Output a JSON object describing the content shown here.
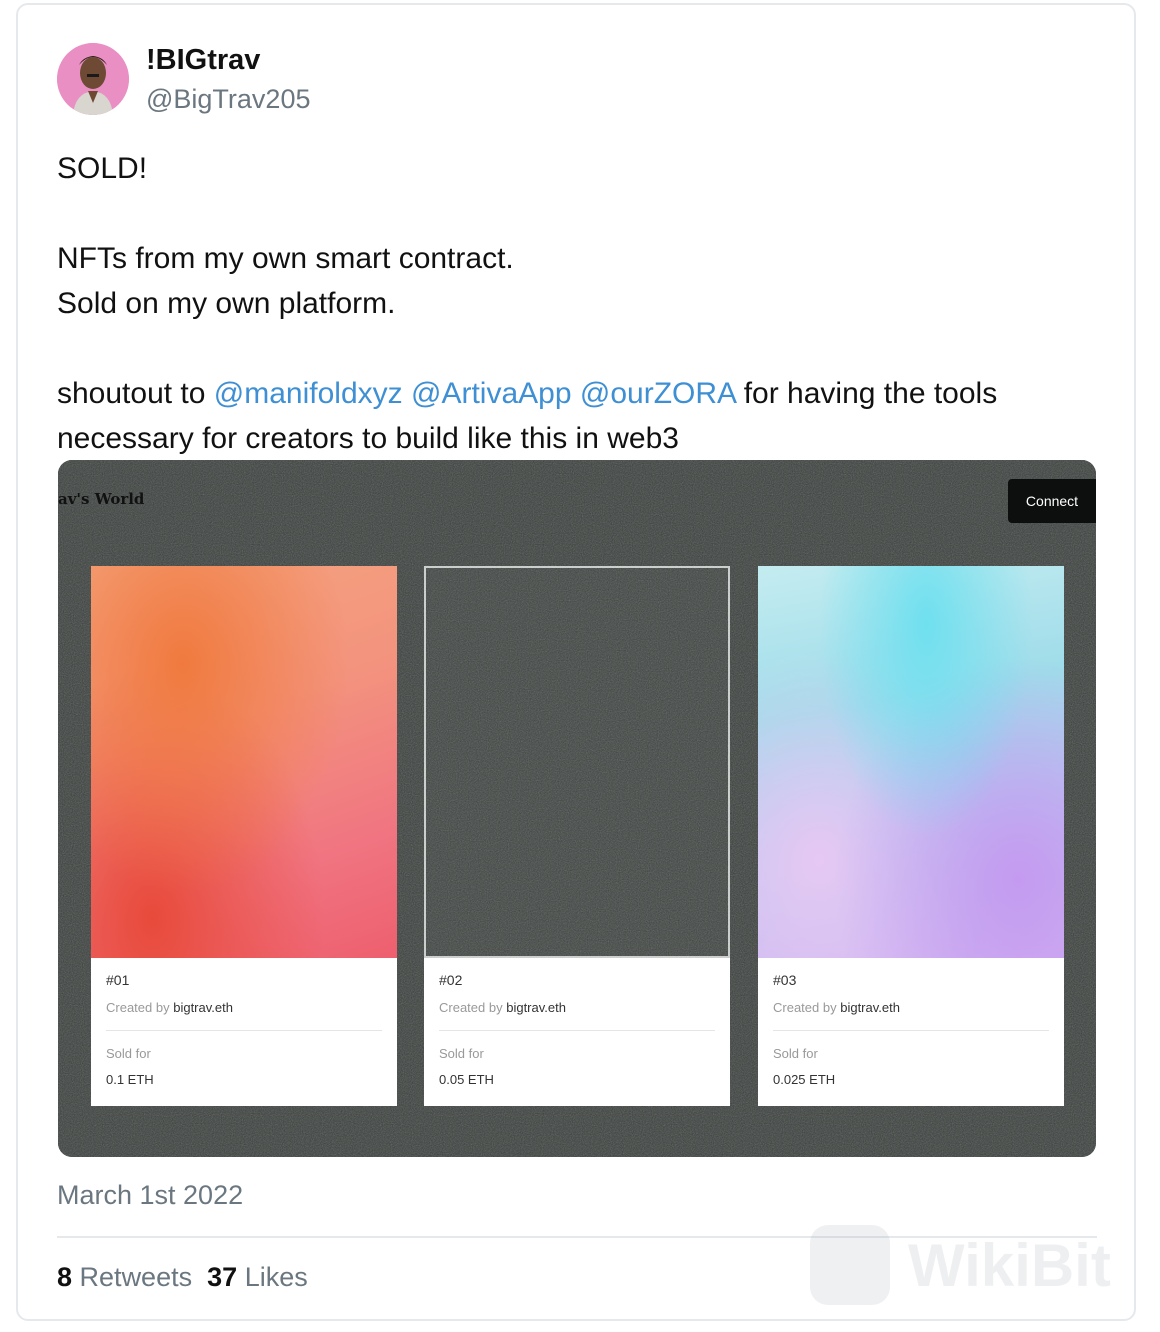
{
  "author": {
    "display_name": "!BIGtrav",
    "handle": "@BigTrav205"
  },
  "tweet": {
    "line1": "SOLD!",
    "line2": "NFTs from my own smart contract.",
    "line3": "Sold on my own platform.",
    "line4_pre": "shoutout to ",
    "mentions": [
      "@manifoldxyz",
      "@ArtivaApp",
      "@ourZORA"
    ],
    "line4_post": " for having the tools",
    "line5": "necessary for creators to build like this in web3"
  },
  "media": {
    "site_title": "av's World",
    "connect_label": "Connect",
    "nfts": [
      {
        "number": "#01",
        "created_by_label": "Created by",
        "creator": "bigtrav.eth",
        "sold_label": "Sold for",
        "price": "0.1 ETH"
      },
      {
        "number": "#02",
        "created_by_label": "Created by",
        "creator": "bigtrav.eth",
        "sold_label": "Sold for",
        "price": "0.05 ETH"
      },
      {
        "number": "#03",
        "created_by_label": "Created by",
        "creator": "bigtrav.eth",
        "sold_label": "Sold for",
        "price": "0.025 ETH"
      }
    ]
  },
  "timestamp": "March 1st 2022",
  "stats": {
    "retweets_count": "8",
    "retweets_label": "Retweets",
    "likes_count": "37",
    "likes_label": "Likes"
  },
  "watermark": "WikiBit",
  "colors": {
    "mention": "#3e8fd3",
    "muted": "#6b7780",
    "media_bg": "#353a37"
  }
}
